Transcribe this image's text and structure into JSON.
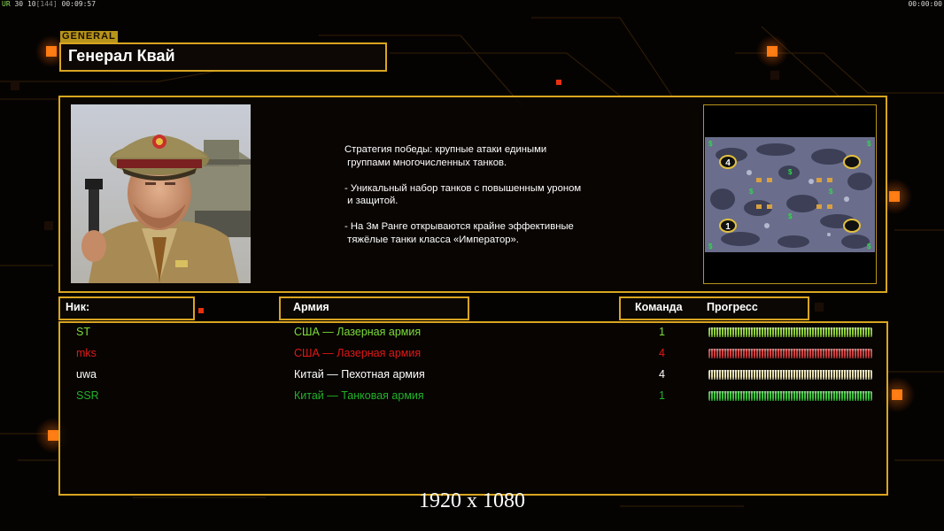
{
  "hud": {
    "top_left_prefix": "UR",
    "top_left_fps": "30",
    "top_left_a": "10",
    "top_left_b": "[144]",
    "top_left_time": "00:09:57",
    "top_right_time": "00:00:00"
  },
  "general": {
    "tag": "GENERAL",
    "name": "Генерал Квай",
    "description": "Стратегия победы: крупные атаки едиными\n группами многочисленных танков.\n\n- Уникальный набор танков с повышенным уроном\n и защитой.\n\n- На 3м Ранге открываются крайне эффективные\n тяжёлые танки класса «Император»."
  },
  "minimap": {
    "spawns": [
      "4",
      "1"
    ]
  },
  "table": {
    "headers": {
      "nick": "Ник:",
      "army": "Армия",
      "team": "Команда",
      "progress": "Прогресс"
    },
    "rows": [
      {
        "nick": "ST",
        "army": "США — Лазерная армия",
        "team": "1",
        "color": "#7ddc3a",
        "bar": "#8fcf3a",
        "progress": 1
      },
      {
        "nick": "mks",
        "army": "США — Лазерная армия",
        "team": "4",
        "color": "#e01818",
        "bar": "#d04040",
        "progress": 1
      },
      {
        "nick": "uwa",
        "army": "Китай — Пехотная армия",
        "team": "4",
        "color": "#ffffff",
        "bar": "#e8e0b0",
        "progress": 1
      },
      {
        "nick": "SSR",
        "army": "Китай — Танковая армия",
        "team": "1",
        "color": "#22b22a",
        "bar": "#3ec43e",
        "progress": 1
      }
    ]
  },
  "resolution_label": "1920 x 1080",
  "colors": {
    "accent": "#d9a520",
    "glow": "#ff7a10"
  }
}
